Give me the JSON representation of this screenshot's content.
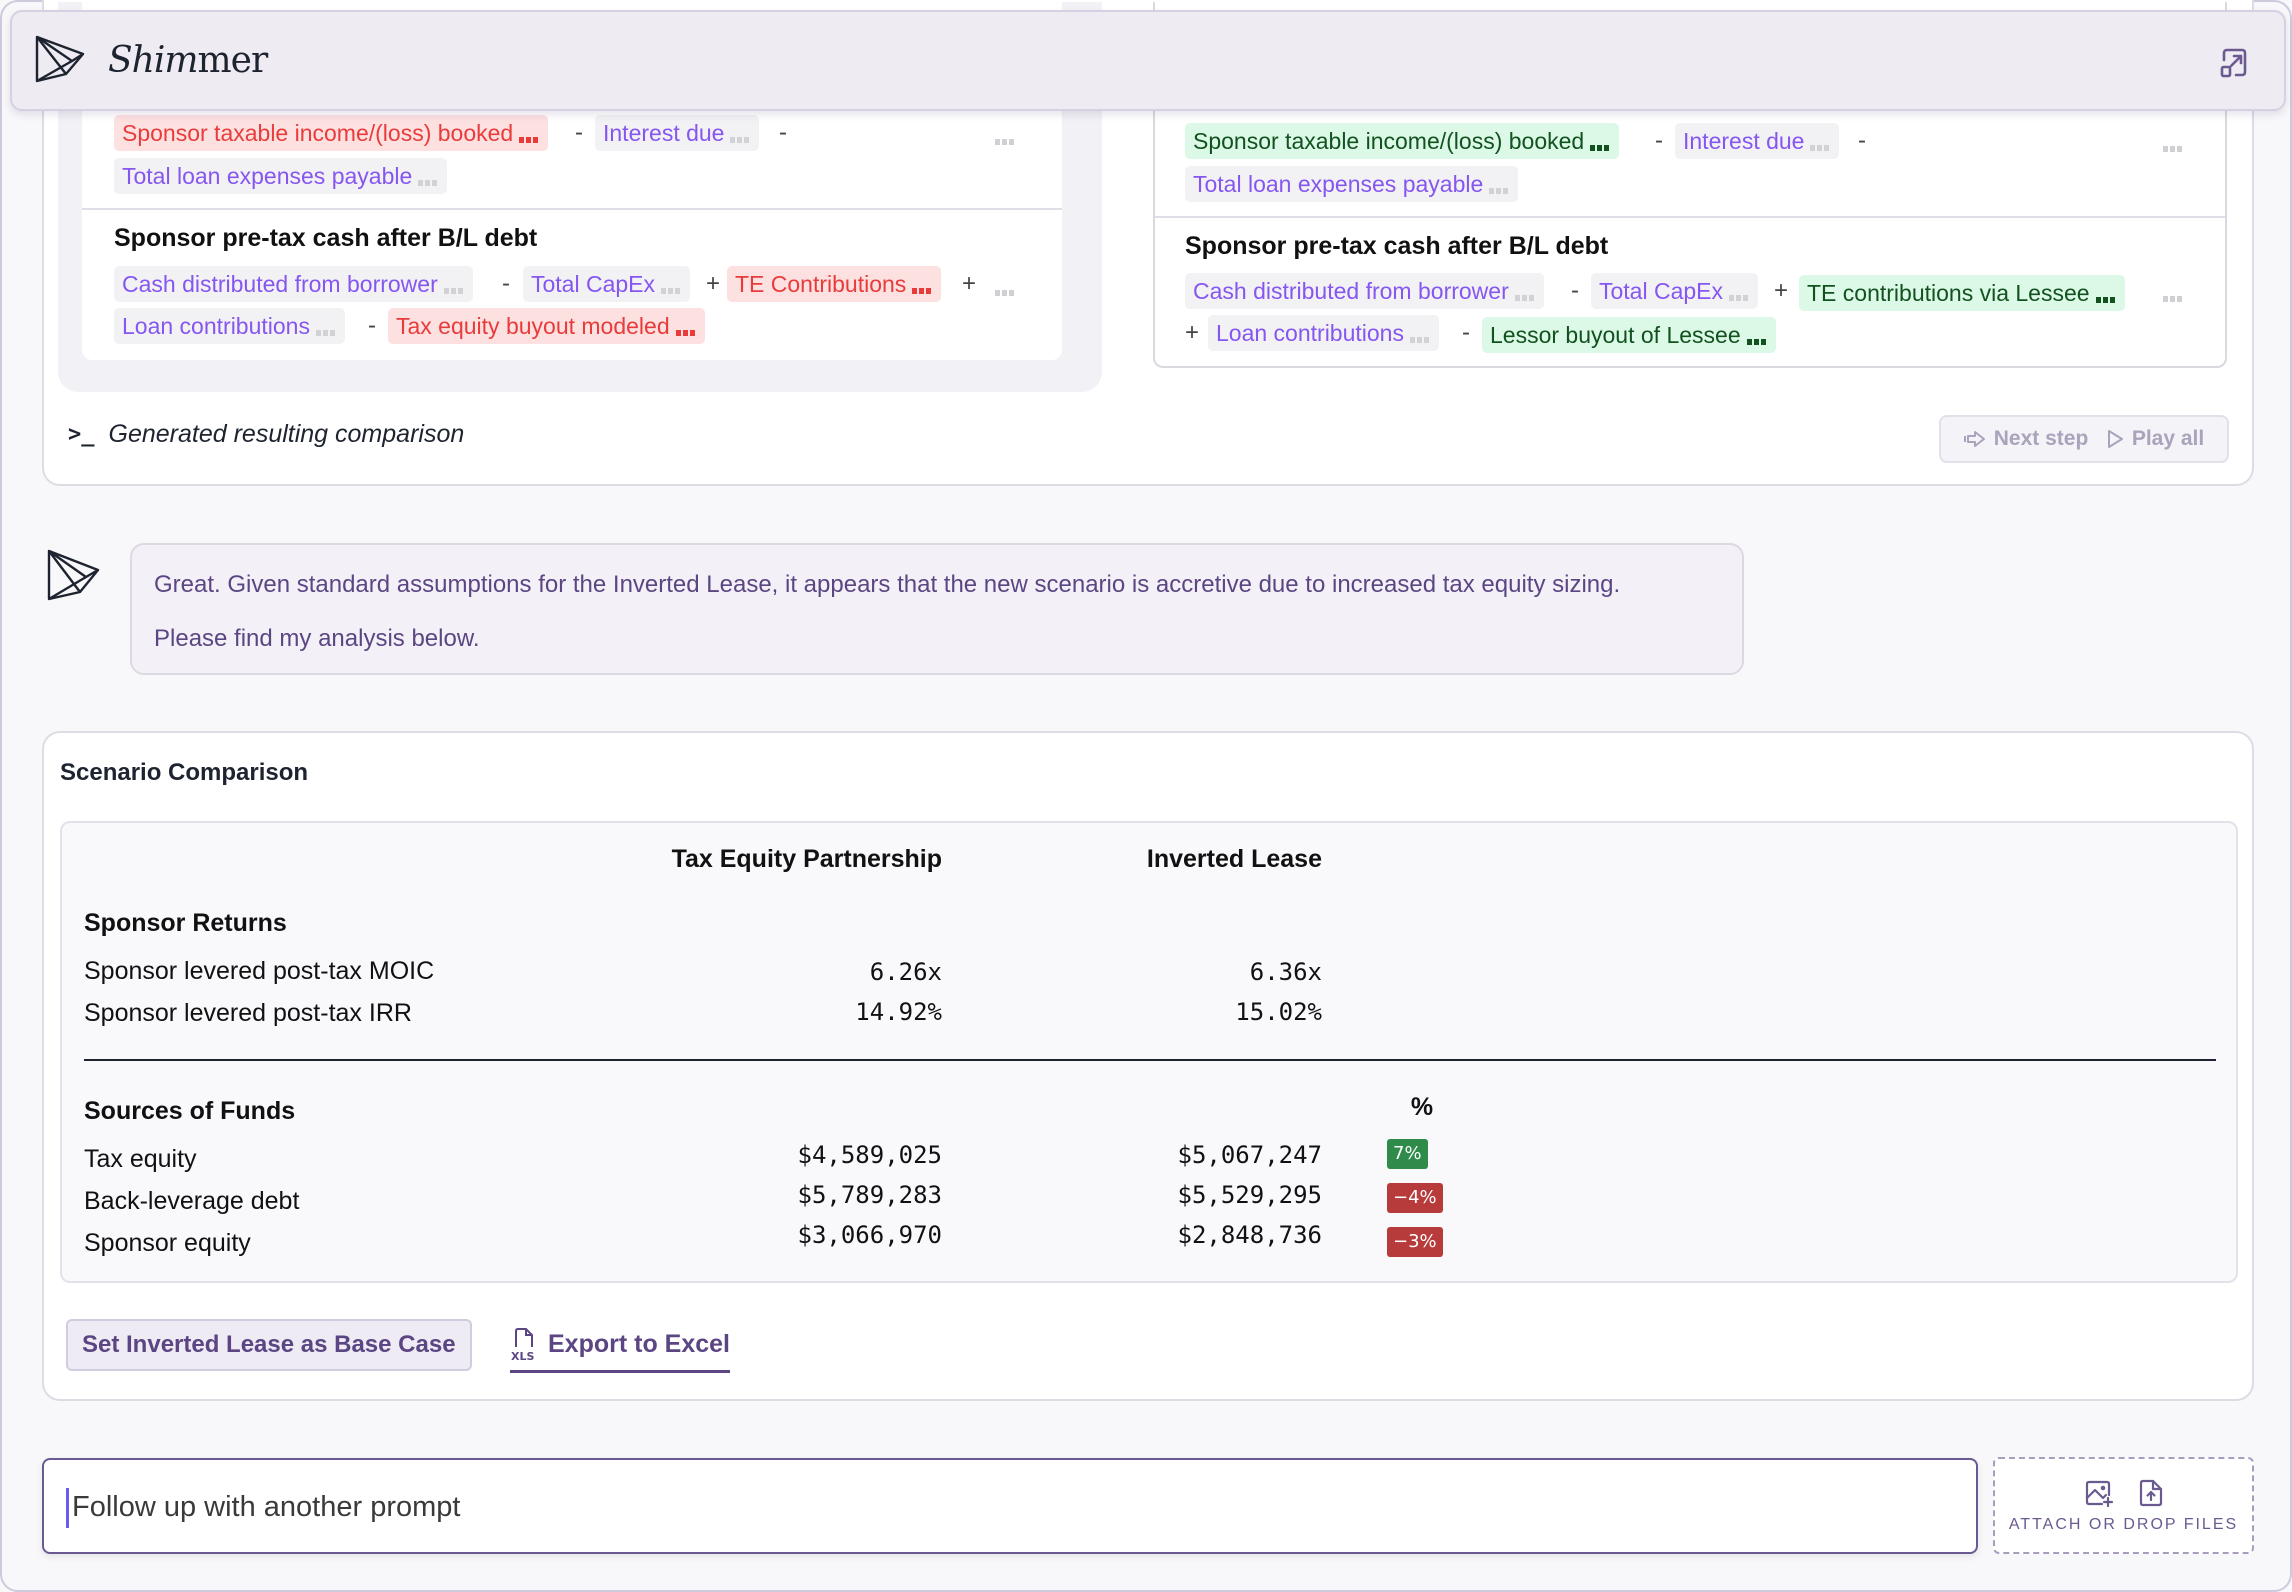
{
  "app": {
    "brand_prefix": "Shim",
    "brand_suffix": "mer",
    "expand_icon": "expand-window-icon"
  },
  "formula_compare": {
    "left": {
      "row1": {
        "chips": [
          {
            "label": "Sponsor taxable income/(loss) booked",
            "state": "removed"
          },
          {
            "label": "Interest due",
            "state": "unchanged"
          },
          {
            "label": "Total loan expenses payable",
            "state": "unchanged"
          }
        ],
        "ops": [
          "-",
          "-"
        ]
      },
      "row2": {
        "title": "Sponsor pre-tax cash after B/L debt",
        "chips": [
          {
            "label": "Cash distributed from borrower",
            "state": "unchanged"
          },
          {
            "label": "Total CapEx",
            "state": "unchanged"
          },
          {
            "label": "TE Contributions",
            "state": "removed"
          },
          {
            "label": "Loan contributions",
            "state": "unchanged"
          },
          {
            "label": "Tax equity buyout modeled",
            "state": "removed"
          }
        ],
        "ops": [
          "-",
          "+",
          "+",
          "-"
        ]
      }
    },
    "right": {
      "row1": {
        "chips": [
          {
            "label": "Sponsor taxable income/(loss) booked",
            "state": "added"
          },
          {
            "label": "Interest due",
            "state": "unchanged"
          },
          {
            "label": "Total loan expenses payable",
            "state": "unchanged"
          }
        ],
        "ops": [
          "-",
          "-"
        ]
      },
      "row2": {
        "title": "Sponsor pre-tax cash after B/L debt",
        "chips": [
          {
            "label": "Cash distributed from borrower",
            "state": "unchanged"
          },
          {
            "label": "Total CapEx",
            "state": "unchanged"
          },
          {
            "label": "TE contributions via Lessee",
            "state": "added"
          },
          {
            "label": "Loan contributions",
            "state": "unchanged"
          },
          {
            "label": "Lessor buyout of Lessee",
            "state": "added"
          }
        ],
        "ops": [
          "-",
          "+",
          "+",
          "-"
        ]
      }
    },
    "generated_label": "Generated resulting comparison",
    "next_step_label": "Next step",
    "play_all_label": "Play all"
  },
  "assistant_message": {
    "line1": "Great. Given standard assumptions for the Inverted Lease, it appears that the new scenario is accretive due to increased tax equity sizing.",
    "line2": "Please find my analysis below."
  },
  "comparison": {
    "title": "Scenario Comparison",
    "columns": [
      "Tax Equity Partnership",
      "Inverted Lease"
    ],
    "pct_header": "%",
    "groups": [
      {
        "label": "Sponsor Returns",
        "rows": [
          {
            "label": "Sponsor levered post-tax MOIC",
            "values": [
              "6.26x",
              "6.36x"
            ]
          },
          {
            "label": "Sponsor levered post-tax IRR",
            "values": [
              "14.92%",
              "15.02%"
            ]
          }
        ]
      },
      {
        "label": "Sources of Funds",
        "rows": [
          {
            "label": "Tax equity",
            "values": [
              "$4,589,025",
              "$5,067,247"
            ],
            "change": "7%",
            "direction": "up"
          },
          {
            "label": "Back-leverage debt",
            "values": [
              "$5,789,283",
              "$5,529,295"
            ],
            "change": "−4%",
            "direction": "down"
          },
          {
            "label": "Sponsor equity",
            "values": [
              "$3,066,970",
              "$2,848,736"
            ],
            "change": "−3%",
            "direction": "down"
          }
        ]
      }
    ],
    "set_base_label": "Set Inverted Lease as Base Case",
    "export_label": "Export to Excel",
    "export_icon_text": "XLS"
  },
  "composer": {
    "placeholder": "Follow up with another prompt",
    "value": "",
    "attach_label": "ATTACH OR DROP FILES"
  },
  "colors": {
    "accent": "#5b4683",
    "chip_text": "#8656f0",
    "removed": "#ea3b3b",
    "added": "#11521f",
    "positive_badge": "#2e8b4a",
    "negative_badge": "#b83b3b"
  }
}
